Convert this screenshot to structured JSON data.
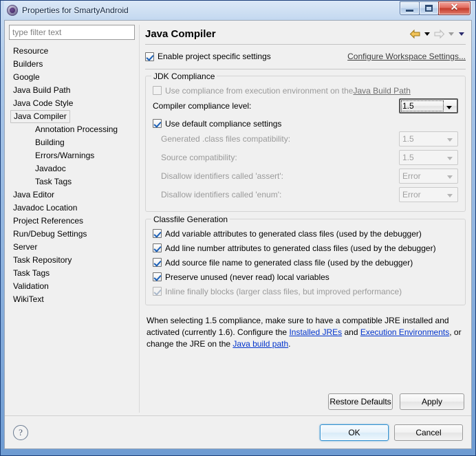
{
  "window": {
    "title": "Properties for SmartyAndroid",
    "icon": "gear-icon",
    "minimize_label": "Minimize",
    "maximize_label": "Maximize",
    "close_label": "Close"
  },
  "sidebar": {
    "filter": {
      "placeholder": "type filter text",
      "value": ""
    },
    "items": [
      {
        "label": "Resource",
        "level": 0,
        "selected": false
      },
      {
        "label": "Builders",
        "level": 0,
        "selected": false
      },
      {
        "label": "Google",
        "level": 0,
        "selected": false
      },
      {
        "label": "Java Build Path",
        "level": 0,
        "selected": false
      },
      {
        "label": "Java Code Style",
        "level": 0,
        "selected": false
      },
      {
        "label": "Java Compiler",
        "level": 0,
        "selected": true
      },
      {
        "label": "Annotation Processing",
        "level": 1,
        "selected": false
      },
      {
        "label": "Building",
        "level": 1,
        "selected": false
      },
      {
        "label": "Errors/Warnings",
        "level": 1,
        "selected": false
      },
      {
        "label": "Javadoc",
        "level": 1,
        "selected": false
      },
      {
        "label": "Task Tags",
        "level": 1,
        "selected": false
      },
      {
        "label": "Java Editor",
        "level": 0,
        "selected": false
      },
      {
        "label": "Javadoc Location",
        "level": 0,
        "selected": false
      },
      {
        "label": "Project References",
        "level": 0,
        "selected": false
      },
      {
        "label": "Run/Debug Settings",
        "level": 0,
        "selected": false
      },
      {
        "label": "Server",
        "level": 0,
        "selected": false
      },
      {
        "label": "Task Repository",
        "level": 0,
        "selected": false
      },
      {
        "label": "Task Tags",
        "level": 0,
        "selected": false
      },
      {
        "label": "Validation",
        "level": 0,
        "selected": false
      },
      {
        "label": "WikiText",
        "level": 0,
        "selected": false
      }
    ]
  },
  "content": {
    "title": "Java Compiler",
    "nav": {
      "back_icon": "back-arrow-icon",
      "forward_icon": "forward-arrow-icon",
      "back_menu_icon": "chevron-down-icon",
      "forward_menu_icon": "chevron-down-icon",
      "view_menu_icon": "chevron-down-icon"
    },
    "enable_project_specific": {
      "label": "Enable project specific settings",
      "checked": true
    },
    "configure_workspace_link": "Configure Workspace Settings...",
    "jdk_compliance": {
      "legend": "JDK Compliance",
      "use_execution_env": {
        "label_before": "Use compliance from execution environment on the ",
        "link": "Java Build Path",
        "checked": false,
        "enabled": false
      },
      "compiler_compliance_level": {
        "label": "Compiler compliance level:",
        "value": "1.5",
        "enabled": true,
        "focused": true
      },
      "use_default_compliance": {
        "label": "Use default compliance settings",
        "checked": true,
        "enabled": true
      },
      "fields": [
        {
          "label": "Generated .class files compatibility:",
          "value": "1.5",
          "enabled": false
        },
        {
          "label": "Source compatibility:",
          "value": "1.5",
          "enabled": false
        },
        {
          "label": "Disallow identifiers called 'assert':",
          "value": "Error",
          "enabled": false
        },
        {
          "label": "Disallow identifiers called 'enum':",
          "value": "Error",
          "enabled": false
        }
      ]
    },
    "classfile_generation": {
      "legend": "Classfile Generation",
      "options": [
        {
          "label": "Add variable attributes to generated class files (used by the debugger)",
          "checked": true,
          "enabled": true
        },
        {
          "label": "Add line number attributes to generated class files (used by the debugger)",
          "checked": true,
          "enabled": true
        },
        {
          "label": "Add source file name to generated class file (used by the debugger)",
          "checked": true,
          "enabled": true
        },
        {
          "label": "Preserve unused (never read) local variables",
          "checked": true,
          "enabled": true
        },
        {
          "label": "Inline finally blocks (larger class files, but improved performance)",
          "checked": true,
          "enabled": false
        }
      ]
    },
    "info": {
      "part1": "When selecting 1.5 compliance, make sure to have a compatible JRE installed and activated (currently 1.6). Configure the ",
      "link1": "Installed JREs",
      "part2": " and ",
      "link2": "Execution Environments",
      "part3": ", or change the JRE on the ",
      "link3": "Java build path",
      "part4": "."
    },
    "restore_defaults_button": "Restore Defaults",
    "apply_button": "Apply"
  },
  "footer": {
    "help_icon": "help-icon",
    "help_glyph": "?",
    "ok_button": "OK",
    "cancel_button": "Cancel"
  },
  "colors": {
    "link": "#0033cc",
    "accent": "#2f8fd0",
    "title_gradient_top": "#c9dcf2",
    "close_button": "#c53c2c",
    "dialog_bg": "#f0f0f0"
  }
}
